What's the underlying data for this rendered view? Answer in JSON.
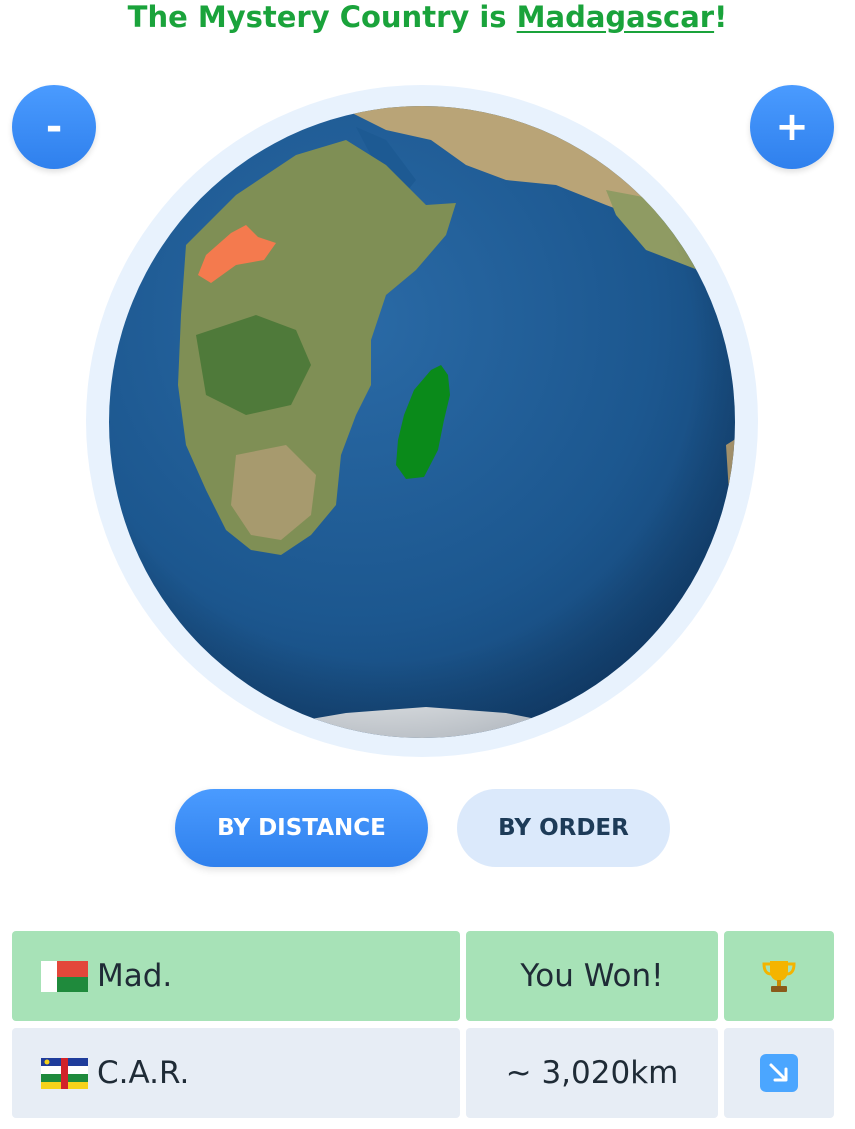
{
  "header": {
    "prefix": "The Mystery Country is ",
    "country": "Madagascar",
    "suffix": "!"
  },
  "zoom": {
    "out_label": "-",
    "in_label": "+"
  },
  "tabs": [
    {
      "label": "BY DISTANCE",
      "active": true
    },
    {
      "label": "BY ORDER",
      "active": false
    }
  ],
  "guesses": [
    {
      "country": "Mad.",
      "distance": "You Won!",
      "status_icon": "trophy-icon"
    },
    {
      "country": "C.A.R.",
      "distance": "~ 3,020km",
      "status_icon": "arrow-down-right-icon"
    }
  ],
  "colors": {
    "title": "#1aa33b",
    "answer_country": "#0a8a1a",
    "guessed_country": "#f47a4e",
    "ocean": "#1d5a93",
    "win_row": "#a7e2b7",
    "guess_row": "#e7edf5",
    "accent": "#2f80ed"
  }
}
